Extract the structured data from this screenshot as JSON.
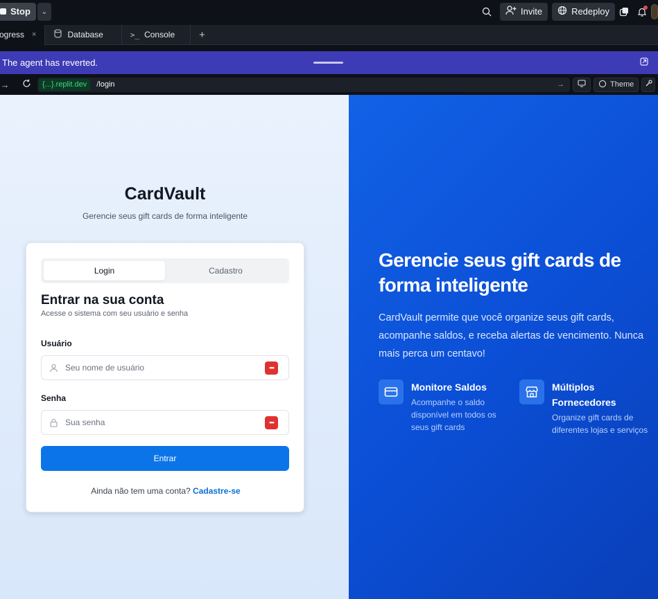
{
  "topbar": {
    "stop_label": "Stop",
    "invite_label": "Invite",
    "redeploy_label": "Redeploy"
  },
  "tabs": [
    {
      "label": "Progress",
      "active": true
    },
    {
      "label": "Database",
      "active": false
    },
    {
      "label": "Console",
      "active": false
    }
  ],
  "banner": {
    "text": "The agent has reverted."
  },
  "urlbar": {
    "host": "{...}.replit.dev",
    "path": "/login",
    "theme_label": "Theme"
  },
  "app": {
    "brand": "CardVault",
    "brand_subtitle": "Gerencie seus gift cards de forma inteligente",
    "tabs": {
      "login": "Login",
      "signup": "Cadastro"
    },
    "form": {
      "title": "Entrar na sua conta",
      "subtitle": "Acesse o sistema com seu usuário e senha",
      "username_label": "Usuário",
      "username_placeholder": "Seu nome de usuário",
      "password_label": "Senha",
      "password_placeholder": "Sua senha",
      "submit_label": "Entrar",
      "no_account_text": "Ainda não tem uma conta?",
      "signup_link": "Cadastre-se"
    },
    "hero": {
      "title": "Gerencie seus gift cards de forma inteligente",
      "text": "CardVault permite que você organize seus gift cards, acompanhe saldos, e receba alertas de vencimento. Nunca mais perca um centavo!",
      "features": [
        {
          "icon": "credit-card-icon",
          "title": "Monitore Saldos",
          "desc": "Acompanhe o saldo disponível em todos os seus gift cards"
        },
        {
          "icon": "store-icon",
          "title": "Múltiplos Fornecedores",
          "desc": "Organize gift cards de diferentes lojas e serviços"
        }
      ]
    }
  },
  "colors": {
    "banner": "#3e3bb6",
    "primary_button": "#0b74e8",
    "hero_bg": "#0b4fd6",
    "password_manager": "#e03131"
  }
}
